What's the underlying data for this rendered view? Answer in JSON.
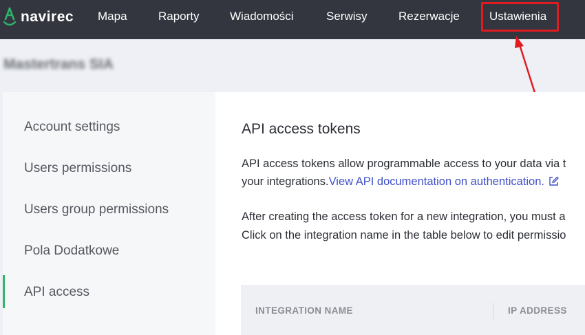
{
  "app": {
    "logo_text": "navirec",
    "logo_icon": "navirec-logo-icon"
  },
  "nav": {
    "items": [
      {
        "label": "Mapa"
      },
      {
        "label": "Raporty"
      },
      {
        "label": "Wiadomości"
      },
      {
        "label": "Serwisy"
      },
      {
        "label": "Rezerwacje"
      },
      {
        "label": "Ustawienia",
        "active": true
      }
    ]
  },
  "annotation": {
    "highlight_color": "#e01b22",
    "target": "Ustawienia"
  },
  "company": {
    "name": "Mastertrans SIA"
  },
  "sidebar": {
    "items": [
      {
        "label": "Account settings"
      },
      {
        "label": "Users permissions"
      },
      {
        "label": "Users group permissions"
      },
      {
        "label": "Pola Dodatkowe"
      },
      {
        "label": "API access",
        "active": true
      }
    ],
    "active_color": "#2fb36b"
  },
  "main": {
    "title": "API access tokens",
    "intro_line1": "API access tokens allow programmable access to your data via t",
    "intro_line2_prefix": "your integrations.",
    "doc_link": "View API documentation on authentication.",
    "doc_link_icon": "external-link-icon",
    "info_line1": "After creating the access token for a new integration, you must a",
    "info_line2": "Click on the integration name in the table below to edit permissio",
    "table": {
      "columns": [
        "INTEGRATION NAME",
        "IP ADDRESS"
      ]
    }
  },
  "colors": {
    "topbar": "#33363f",
    "link": "#3f4fc9",
    "page_bg": "#eef0f5"
  }
}
